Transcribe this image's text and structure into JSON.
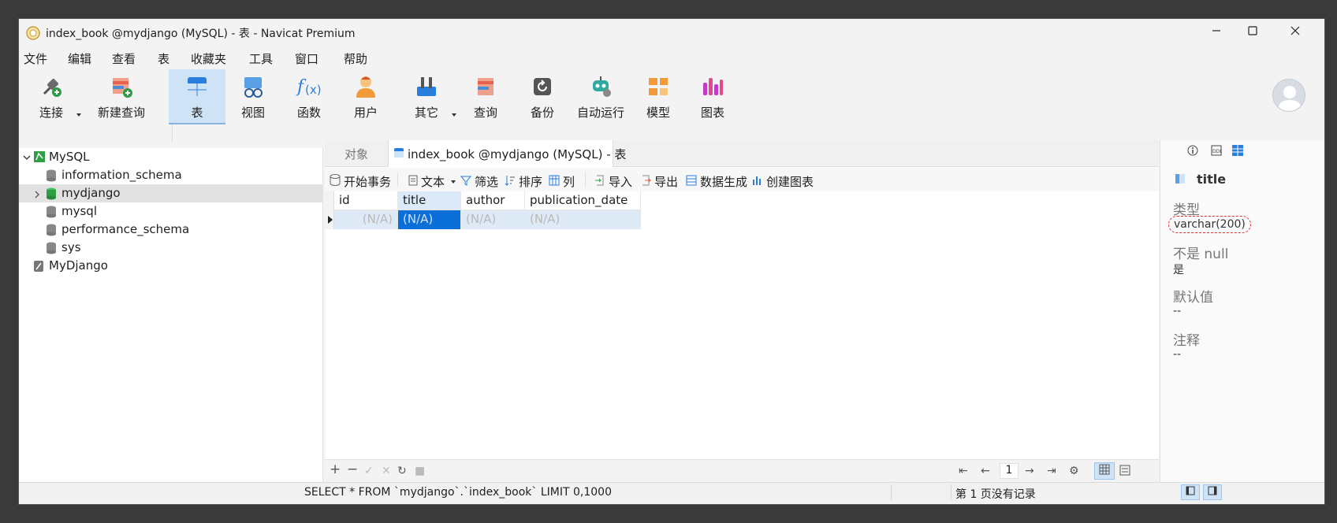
{
  "window": {
    "title": "index_book @mydjango (MySQL) - 表 - Navicat Premium"
  },
  "menu": [
    "文件",
    "编辑",
    "查看",
    "表",
    "收藏夹",
    "工具",
    "窗口",
    "帮助"
  ],
  "toolbar": {
    "items": [
      "连接",
      "新建查询",
      "表",
      "视图",
      "函数",
      "用户",
      "其它",
      "查询",
      "备份",
      "自动运行",
      "模型",
      "图表"
    ],
    "active": "表"
  },
  "sidebar": {
    "connections": [
      {
        "label": "MySQL"
      },
      {
        "label": "MyDjango"
      }
    ],
    "databases": [
      "information_schema",
      "mydjango",
      "mysql",
      "performance_schema",
      "sys"
    ],
    "selected": "mydjango"
  },
  "tabs": {
    "objects_label": "对象",
    "active_label": "index_book @mydjango (MySQL) - 表"
  },
  "subtoolbar": {
    "begin_transaction": "开始事务",
    "text": "文本",
    "filter": "筛选",
    "sort": "排序",
    "columns": "列",
    "import": "导入",
    "export": "导出",
    "data_generation": "数据生成",
    "create_chart": "创建图表"
  },
  "grid": {
    "columns": [
      "id",
      "title",
      "author",
      "publication_date"
    ],
    "row": [
      "(N/A)",
      "(N/A)",
      "(N/A)",
      "(N/A)"
    ],
    "selected_column": "title"
  },
  "pager": {
    "page": "1"
  },
  "status": {
    "sql": "SELECT * FROM `mydjango`.`index_book` LIMIT 0,1000",
    "records": "第 1 页没有记录"
  },
  "properties": {
    "field_name": "title",
    "type_label": "类型",
    "type_value": "varchar(200)",
    "not_null_label": "不是 null",
    "not_null_value": "是",
    "default_label": "默认值",
    "default_value": "--",
    "comment_label": "注释",
    "comment_value": "--"
  },
  "colors": {
    "accent": "#0a6fd8",
    "selected_tab_bg": "#cfe3f6",
    "highlight_circle": "#e03030"
  }
}
